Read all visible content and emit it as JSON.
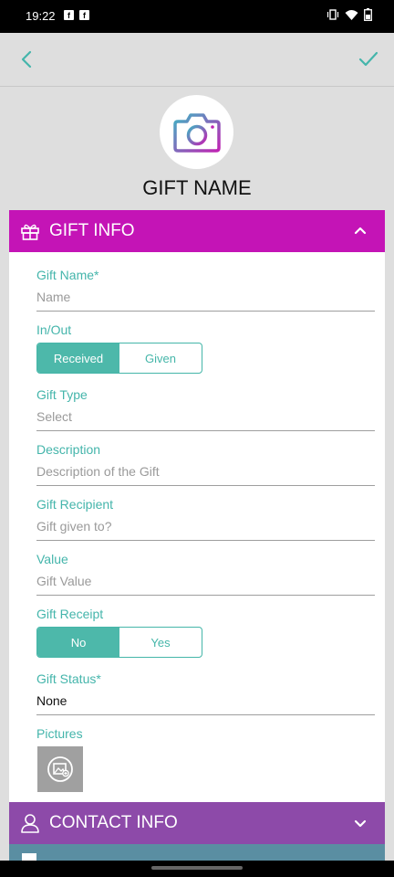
{
  "status_bar": {
    "time": "19:22",
    "notifications": [
      "f",
      "f"
    ]
  },
  "header": {
    "title": "GIFT NAME"
  },
  "sections": {
    "gift_info": "GIFT INFO",
    "contact_info": "CONTACT INFO"
  },
  "form": {
    "gift_name": {
      "label": "Gift Name*",
      "placeholder": "Name"
    },
    "in_out": {
      "label": "In/Out",
      "options": [
        "Received",
        "Given"
      ],
      "selected": "Received"
    },
    "gift_type": {
      "label": "Gift Type",
      "placeholder": "Select"
    },
    "description": {
      "label": "Description",
      "placeholder": "Description of the Gift"
    },
    "recipient": {
      "label": "Gift Recipient",
      "placeholder": "Gift given to?"
    },
    "value": {
      "label": "Value",
      "placeholder": "Gift Value"
    },
    "receipt": {
      "label": "Gift Receipt",
      "options": [
        "No",
        "Yes"
      ],
      "selected": "No"
    },
    "status": {
      "label": "Gift Status*",
      "value": "None"
    },
    "pictures": {
      "label": "Pictures"
    }
  },
  "colors": {
    "accent": "#44b5ab",
    "gift_header": "#c414b6",
    "contact_header": "#8d4aa9"
  }
}
